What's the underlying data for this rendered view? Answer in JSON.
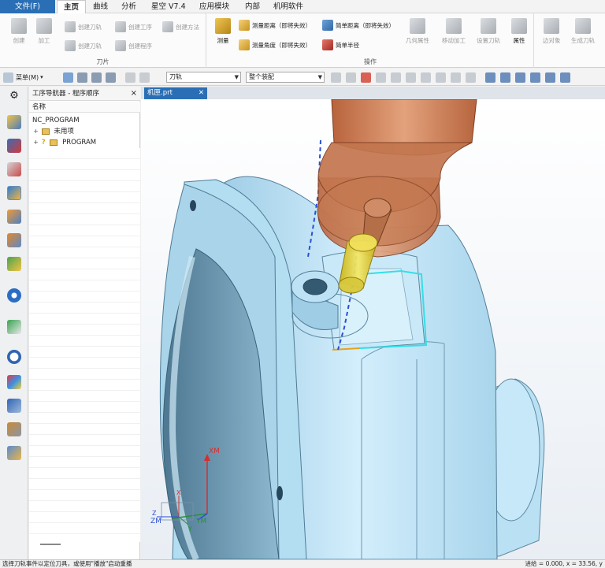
{
  "menu": {
    "file": "文件(F)",
    "tabs": [
      "主页",
      "曲线",
      "分析",
      "星空 V7.4",
      "应用模块",
      "内部",
      "机明软件"
    ]
  },
  "ribbon": {
    "groups": [
      {
        "label": "刀片",
        "buttons": [
          "创建",
          "加工",
          "创建刀轨",
          "创建工序",
          "创建方法",
          "刀片",
          "创建刀轨",
          "创建程序"
        ]
      },
      {
        "label": "操作",
        "buttons": [
          "测量",
          "测量距离（即将失效）",
          "测量角度（即将失效）",
          "简单距离（即将失效）",
          "简单半径",
          "几何属性",
          "移动加工",
          "设置刀轨"
        ]
      }
    ],
    "property_label": "属性",
    "right_group": [
      "边对象",
      "生成刀轨"
    ]
  },
  "toolbar": {
    "menu_label": "菜单(M)",
    "filter_select": "刀轨",
    "assembly_select": "整个装配"
  },
  "navigator": {
    "title": "工序导航器 - 程序顺序",
    "column_header": "名称",
    "rows": [
      {
        "label": "NC_PROGRAM",
        "level": 0
      },
      {
        "label": "未用项",
        "level": 1
      },
      {
        "label": "PROGRAM",
        "level": 1
      }
    ]
  },
  "viewport": {
    "doc_tab": "机匣.prt",
    "axis_labels": {
      "xm": "XM",
      "ym": "YM",
      "zm": "ZM",
      "x": "X",
      "y": "Y",
      "z": "Z"
    }
  },
  "status": {
    "message": "选择刀轨事件以定位刀具，或使用\"播放\"启动重播",
    "coordinates": "进给 = 0.000, x = 33.56, y"
  },
  "colors": {
    "file_tab": "#2a6fb5",
    "part_surface": "#bfe3f5",
    "tool_holder": "#c97e55",
    "cutter": "#e3d23a",
    "toolpath": "#33dfe8",
    "toolpath_dash": "#2a4fd6"
  }
}
